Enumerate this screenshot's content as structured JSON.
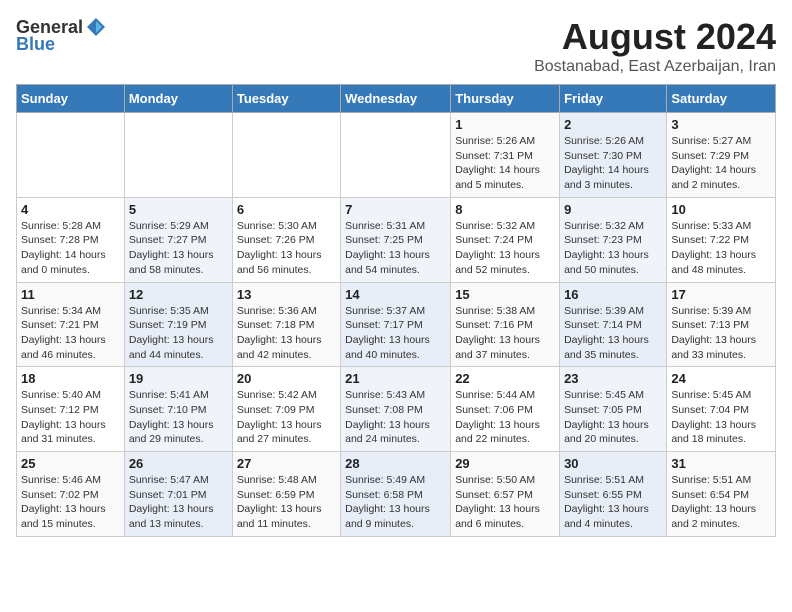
{
  "logo": {
    "general": "General",
    "blue": "Blue"
  },
  "title": "August 2024",
  "location": "Bostanabad, East Azerbaijan, Iran",
  "days_of_week": [
    "Sunday",
    "Monday",
    "Tuesday",
    "Wednesday",
    "Thursday",
    "Friday",
    "Saturday"
  ],
  "weeks": [
    [
      {
        "day": "",
        "info": ""
      },
      {
        "day": "",
        "info": ""
      },
      {
        "day": "",
        "info": ""
      },
      {
        "day": "",
        "info": ""
      },
      {
        "day": "1",
        "info": "Sunrise: 5:26 AM\nSunset: 7:31 PM\nDaylight: 14 hours\nand 5 minutes."
      },
      {
        "day": "2",
        "info": "Sunrise: 5:26 AM\nSunset: 7:30 PM\nDaylight: 14 hours\nand 3 minutes."
      },
      {
        "day": "3",
        "info": "Sunrise: 5:27 AM\nSunset: 7:29 PM\nDaylight: 14 hours\nand 2 minutes."
      }
    ],
    [
      {
        "day": "4",
        "info": "Sunrise: 5:28 AM\nSunset: 7:28 PM\nDaylight: 14 hours\nand 0 minutes."
      },
      {
        "day": "5",
        "info": "Sunrise: 5:29 AM\nSunset: 7:27 PM\nDaylight: 13 hours\nand 58 minutes."
      },
      {
        "day": "6",
        "info": "Sunrise: 5:30 AM\nSunset: 7:26 PM\nDaylight: 13 hours\nand 56 minutes."
      },
      {
        "day": "7",
        "info": "Sunrise: 5:31 AM\nSunset: 7:25 PM\nDaylight: 13 hours\nand 54 minutes."
      },
      {
        "day": "8",
        "info": "Sunrise: 5:32 AM\nSunset: 7:24 PM\nDaylight: 13 hours\nand 52 minutes."
      },
      {
        "day": "9",
        "info": "Sunrise: 5:32 AM\nSunset: 7:23 PM\nDaylight: 13 hours\nand 50 minutes."
      },
      {
        "day": "10",
        "info": "Sunrise: 5:33 AM\nSunset: 7:22 PM\nDaylight: 13 hours\nand 48 minutes."
      }
    ],
    [
      {
        "day": "11",
        "info": "Sunrise: 5:34 AM\nSunset: 7:21 PM\nDaylight: 13 hours\nand 46 minutes."
      },
      {
        "day": "12",
        "info": "Sunrise: 5:35 AM\nSunset: 7:19 PM\nDaylight: 13 hours\nand 44 minutes."
      },
      {
        "day": "13",
        "info": "Sunrise: 5:36 AM\nSunset: 7:18 PM\nDaylight: 13 hours\nand 42 minutes."
      },
      {
        "day": "14",
        "info": "Sunrise: 5:37 AM\nSunset: 7:17 PM\nDaylight: 13 hours\nand 40 minutes."
      },
      {
        "day": "15",
        "info": "Sunrise: 5:38 AM\nSunset: 7:16 PM\nDaylight: 13 hours\nand 37 minutes."
      },
      {
        "day": "16",
        "info": "Sunrise: 5:39 AM\nSunset: 7:14 PM\nDaylight: 13 hours\nand 35 minutes."
      },
      {
        "day": "17",
        "info": "Sunrise: 5:39 AM\nSunset: 7:13 PM\nDaylight: 13 hours\nand 33 minutes."
      }
    ],
    [
      {
        "day": "18",
        "info": "Sunrise: 5:40 AM\nSunset: 7:12 PM\nDaylight: 13 hours\nand 31 minutes."
      },
      {
        "day": "19",
        "info": "Sunrise: 5:41 AM\nSunset: 7:10 PM\nDaylight: 13 hours\nand 29 minutes."
      },
      {
        "day": "20",
        "info": "Sunrise: 5:42 AM\nSunset: 7:09 PM\nDaylight: 13 hours\nand 27 minutes."
      },
      {
        "day": "21",
        "info": "Sunrise: 5:43 AM\nSunset: 7:08 PM\nDaylight: 13 hours\nand 24 minutes."
      },
      {
        "day": "22",
        "info": "Sunrise: 5:44 AM\nSunset: 7:06 PM\nDaylight: 13 hours\nand 22 minutes."
      },
      {
        "day": "23",
        "info": "Sunrise: 5:45 AM\nSunset: 7:05 PM\nDaylight: 13 hours\nand 20 minutes."
      },
      {
        "day": "24",
        "info": "Sunrise: 5:45 AM\nSunset: 7:04 PM\nDaylight: 13 hours\nand 18 minutes."
      }
    ],
    [
      {
        "day": "25",
        "info": "Sunrise: 5:46 AM\nSunset: 7:02 PM\nDaylight: 13 hours\nand 15 minutes."
      },
      {
        "day": "26",
        "info": "Sunrise: 5:47 AM\nSunset: 7:01 PM\nDaylight: 13 hours\nand 13 minutes."
      },
      {
        "day": "27",
        "info": "Sunrise: 5:48 AM\nSunset: 6:59 PM\nDaylight: 13 hours\nand 11 minutes."
      },
      {
        "day": "28",
        "info": "Sunrise: 5:49 AM\nSunset: 6:58 PM\nDaylight: 13 hours\nand 9 minutes."
      },
      {
        "day": "29",
        "info": "Sunrise: 5:50 AM\nSunset: 6:57 PM\nDaylight: 13 hours\nand 6 minutes."
      },
      {
        "day": "30",
        "info": "Sunrise: 5:51 AM\nSunset: 6:55 PM\nDaylight: 13 hours\nand 4 minutes."
      },
      {
        "day": "31",
        "info": "Sunrise: 5:51 AM\nSunset: 6:54 PM\nDaylight: 13 hours\nand 2 minutes."
      }
    ]
  ]
}
